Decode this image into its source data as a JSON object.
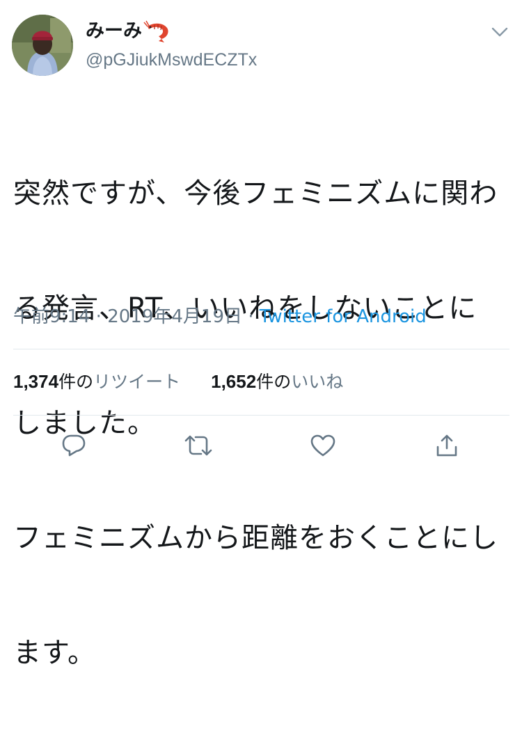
{
  "user": {
    "display_name": "みーみ",
    "name_emoji": "shrimp-emoji",
    "handle": "@pGJiukMswdECZTx"
  },
  "tweet": {
    "lines": [
      "突然ですが、今後フェミニズムに関わ",
      "る発言、RT、いいねをしないことに",
      "しました。",
      "フェミニズムから距離をおくことにし",
      "ます。"
    ]
  },
  "meta": {
    "time": "午前9:14",
    "separator": " · ",
    "date": "2019年4月19日",
    "separator2": " · ",
    "source": "Twitter for Android"
  },
  "stats": {
    "retweets_count": "1,374",
    "retweets_unit": "件の",
    "retweets_label": "リツイート",
    "likes_count": "1,652",
    "likes_unit": "件の",
    "likes_label": "いいね"
  },
  "icons": {
    "caret": "chevron-down-icon",
    "reply": "reply-icon",
    "retweet": "retweet-icon",
    "like": "heart-icon",
    "share": "share-icon"
  },
  "colors": {
    "text": "#14171a",
    "secondary": "#657786",
    "link": "#1b95e0",
    "divider": "#e1e8ed"
  }
}
